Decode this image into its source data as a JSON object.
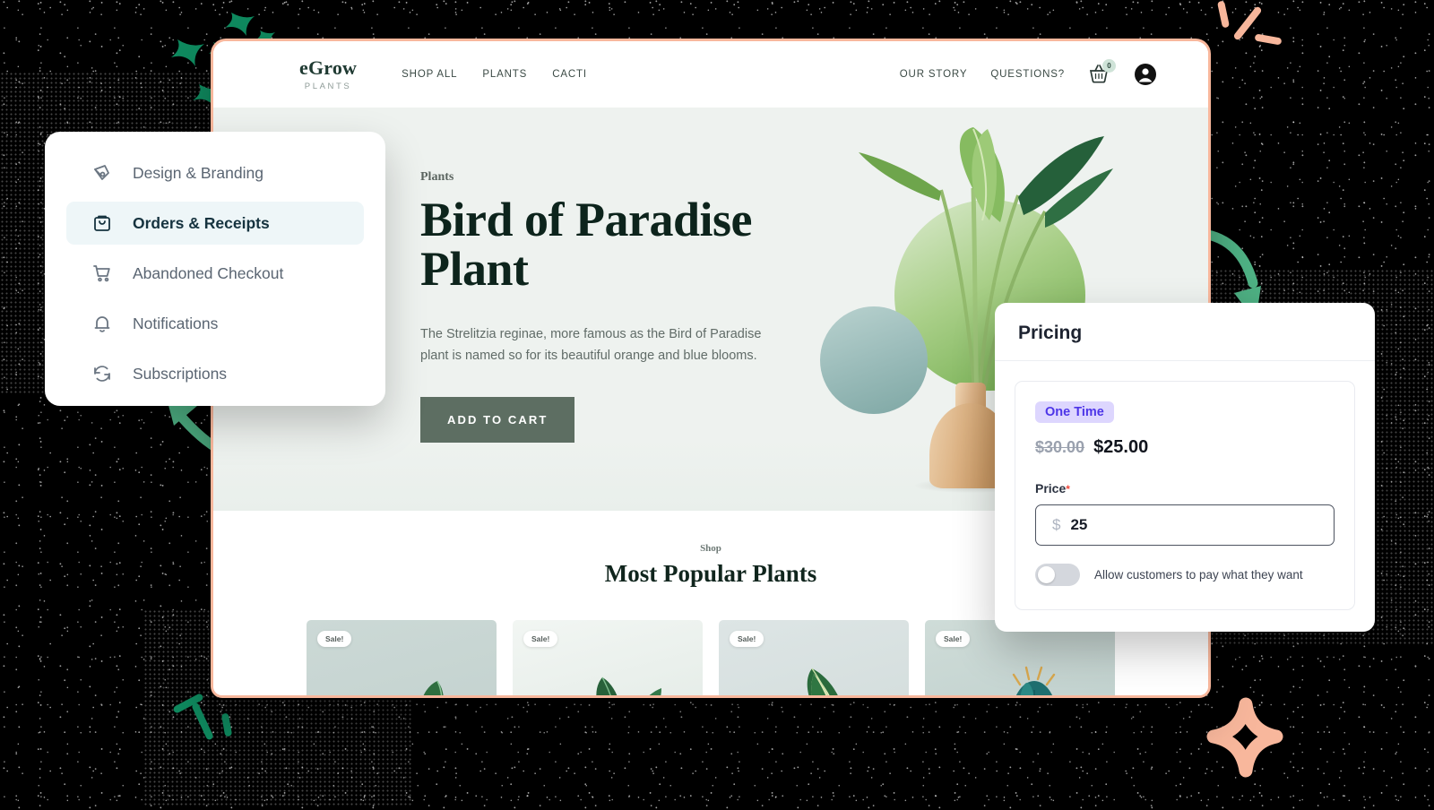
{
  "storefront": {
    "logo": {
      "name": "eGrow",
      "tagline": "PLANTS"
    },
    "nav_left": [
      {
        "label": "SHOP ALL",
        "icon": ""
      },
      {
        "label": "PLANTS",
        "icon": ""
      },
      {
        "label": "CACTI",
        "icon": ""
      }
    ],
    "nav_right": [
      {
        "label": "OUR STORY"
      },
      {
        "label": "QUESTIONS?"
      }
    ],
    "cart": {
      "icon": "basket-icon",
      "count": "0"
    },
    "account": {
      "icon": "user-account-icon"
    },
    "hero": {
      "eyebrow": "Plants",
      "title": "Bird of Paradise Plant",
      "description": "The Strelitzia reginae, more famous as the Bird of Paradise plant is named so for its beautiful orange and blue blooms.",
      "cta": "ADD TO CART"
    },
    "shop": {
      "eyebrow": "Shop",
      "title": "Most Popular Plants",
      "cards": [
        {
          "badge": "Sale!",
          "plant": "rubber-plant"
        },
        {
          "badge": "Sale!",
          "plant": "ficus-plant"
        },
        {
          "badge": "Sale!",
          "plant": "variegated-plant"
        },
        {
          "badge": "Sale!",
          "plant": "cactus-plant"
        }
      ]
    }
  },
  "sidebar": {
    "items": [
      {
        "label": "Design & Branding",
        "icon": "pen-tool-icon",
        "active": false
      },
      {
        "label": "Orders & Receipts",
        "icon": "shopping-bag-icon",
        "active": true
      },
      {
        "label": "Abandoned Checkout",
        "icon": "shopping-cart-icon",
        "active": false
      },
      {
        "label": "Notifications",
        "icon": "bell-icon",
        "active": false
      },
      {
        "label": "Subscriptions",
        "icon": "refresh-sync-icon",
        "active": false
      }
    ]
  },
  "pricing": {
    "title": "Pricing",
    "badge": "One Time",
    "price_old": "$30.00",
    "price_new": "$25.00",
    "price_label": "Price",
    "required_mark": "*",
    "currency_symbol": "$",
    "price_value": "25",
    "toggle_label": "Allow customers to pay what they want",
    "toggle_on": false
  },
  "colors": {
    "accent_green": "#4fb285",
    "accent_salmon": "#f8b79c",
    "brand_green": "#1f3a32",
    "button_green": "#5d6e62",
    "badge_purple_bg": "#ddd6fe",
    "badge_purple_text": "#4d35e8",
    "sidebar_active_bg": "#eef6f8",
    "required_red": "#f0483c"
  }
}
